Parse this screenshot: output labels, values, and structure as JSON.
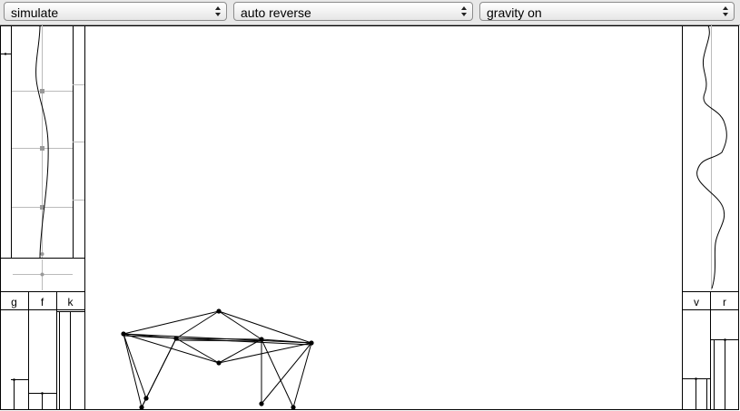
{
  "toolbar": {
    "mode_select": {
      "value": "simulate"
    },
    "reverse_select": {
      "value": "auto reverse"
    },
    "gravity_select": {
      "value": "gravity on"
    }
  },
  "left_panel": {
    "slider_labels": [
      "g",
      "f",
      "k"
    ]
  },
  "right_panel": {
    "slider_labels": [
      "v",
      "r"
    ]
  },
  "colors": {
    "toolbar_bg": "#e8e8e8",
    "border": "#000000",
    "grid": "#bbbbbb"
  }
}
